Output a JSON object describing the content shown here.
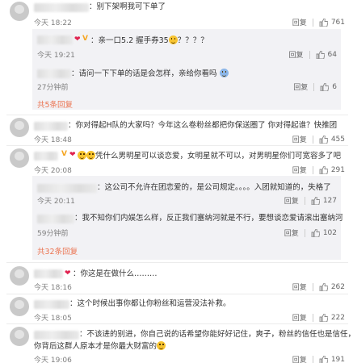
{
  "comments": [
    {
      "text": "：别下架啊我可下单了",
      "time": "今天 18:22",
      "reply": "回复",
      "likes": "761"
    },
    {
      "text": "：你对得起H队的大家吗？今年这么卷粉丝都把你保送圈了 你对得起谁？快推团",
      "time": "今天 18:48",
      "reply": "回复",
      "likes": "455"
    },
    {
      "text": "凭什么男明星可以谈恋爱，女明星就不可以，对男明星你们可宽容多了吧",
      "time": "今天 20:08",
      "reply": "回复",
      "likes": "291"
    },
    {
      "text": "：你这是在做什么………",
      "time": "今天 18:16",
      "reply": "回复",
      "likes": "262"
    },
    {
      "text": "：这个时候出事你都让你粉丝和运营没法补救。",
      "time": "今天 18:05",
      "reply": "回复",
      "likes": "222"
    },
    {
      "text_line1": "：不该进的别进，你自己说的话希望你能好好记住，爽子，粉丝的信任也是信任，",
      "text_line2": "你背后这群人原本才是你最大财富的",
      "time": "今天 19:06",
      "reply": "回复",
      "likes": "191"
    }
  ],
  "thread1": {
    "first": {
      "text": "：亲一口5.2 握手券35",
      "tail": "？？？？",
      "time": "今天 19:21",
      "reply": "回复",
      "likes": "64"
    },
    "second": {
      "text": "：请问一下下单的话是会怎样，亲给你看吗",
      "time": "27分钟前",
      "reply": "回复",
      "likes": "6"
    },
    "more": "共5条回复"
  },
  "thread2": {
    "first": {
      "text": "：这公司不允许在团恋爱的，是公司规定。。。。入团就知道的，失格了",
      "time": "今天 20:11",
      "reply": "回复",
      "likes": "127"
    },
    "second": {
      "text": "：我不知你们内娱怎么样，反正我们塞纳河就是不行，要想谈恋爱请滚出塞纳河",
      "time": "59分钟前",
      "reply": "回复",
      "likes": "102"
    },
    "more": "共32条回复"
  },
  "icons": {
    "thumb": "thumb-up-icon",
    "emoji": "smile-emoji-icon",
    "heart": "heart-icon",
    "vip": "vip-badge-icon"
  },
  "colors": {
    "link": "#eb7350",
    "time": "#808080",
    "subBg": "#f2f2f5"
  }
}
